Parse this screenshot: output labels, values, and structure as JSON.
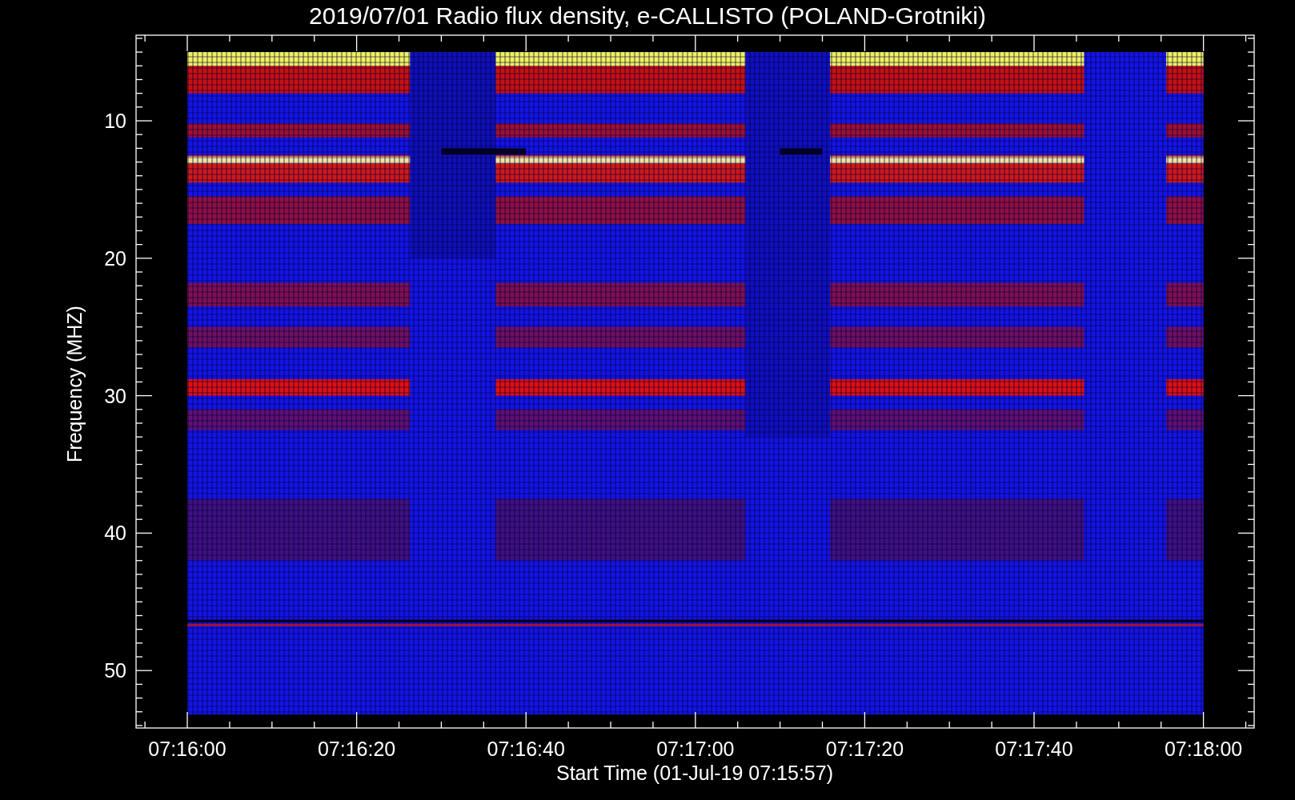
{
  "plot": {
    "title": "2019/07/01  Radio flux density, e-CALLISTO (POLAND-Grotniki)",
    "ylabel": "Frequency (MHZ)",
    "xlabel": "Start Time (01-Jul-19 07:15:57)",
    "y_tick_labels": [
      "10",
      "20",
      "30",
      "40",
      "50"
    ],
    "x_tick_labels": [
      "07:16:00",
      "07:16:20",
      "07:16:40",
      "07:17:00",
      "07:17:20",
      "07:17:40",
      "07:18:00"
    ]
  }
}
